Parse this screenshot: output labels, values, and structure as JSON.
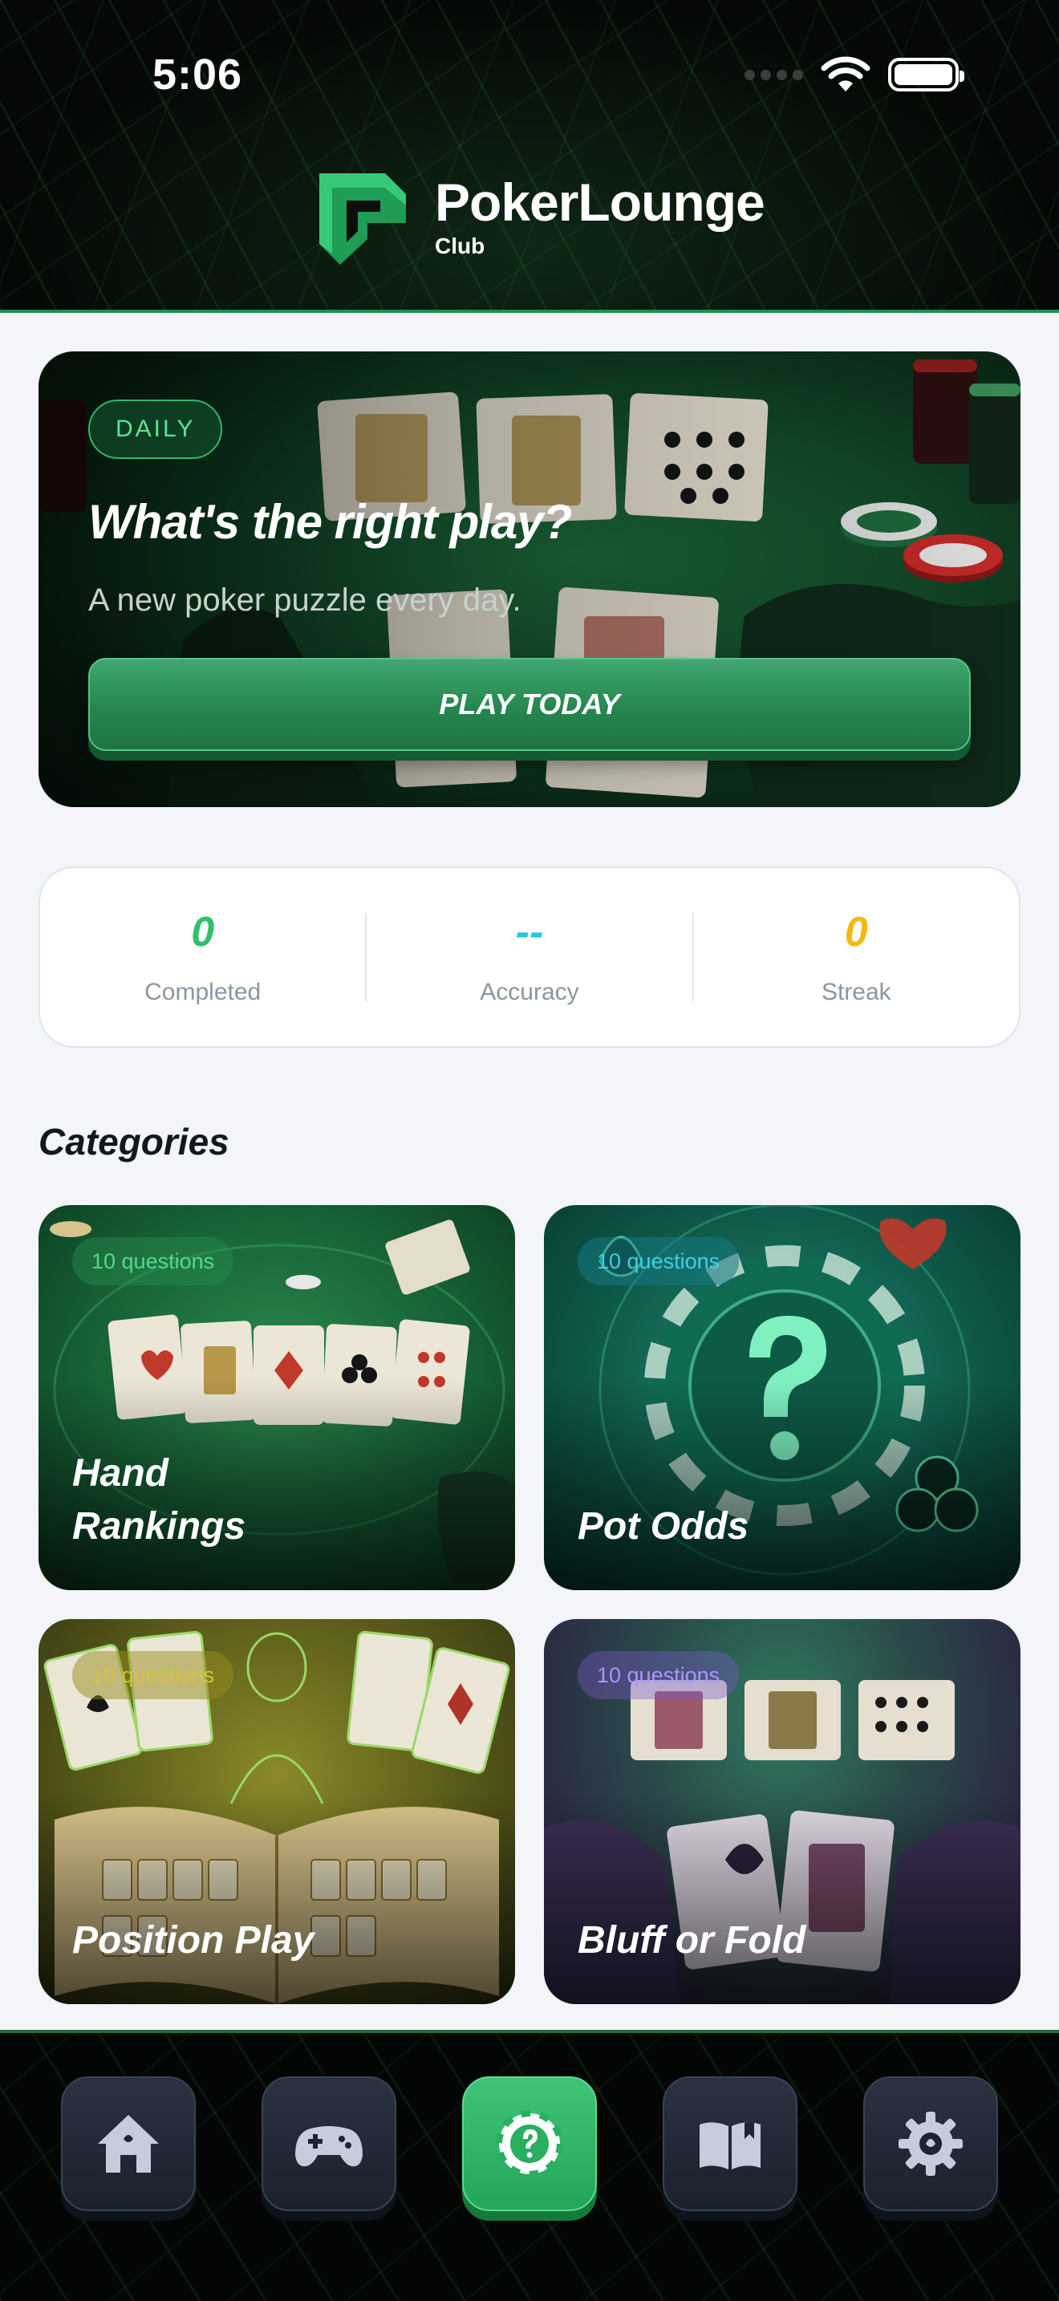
{
  "status_bar": {
    "time": "5:06"
  },
  "brand": {
    "name": "PokerLounge",
    "sub": "Club",
    "accent": "#2fc06b"
  },
  "daily": {
    "badge": "DAILY",
    "title": "What's the right play?",
    "subtitle": "A new poker puzzle every day.",
    "button": "PLAY TODAY"
  },
  "stats": [
    {
      "value": "0",
      "label": "Completed",
      "color": "#2fc06b"
    },
    {
      "value": "--",
      "label": "Accuracy",
      "color": "#27c6e0"
    },
    {
      "value": "0",
      "label": "Streak",
      "color": "#f2b90f"
    }
  ],
  "categories": {
    "title": "Categories",
    "items": [
      {
        "name": "Hand Rankings",
        "count": "10 questions",
        "theme": "green"
      },
      {
        "name": "Pot Odds",
        "count": "10 questions",
        "theme": "teal"
      },
      {
        "name": "Position Play",
        "count": "10 questions",
        "theme": "gold"
      },
      {
        "name": "Bluff or Fold",
        "count": "10 questions",
        "theme": "purple"
      }
    ]
  },
  "nav": {
    "items": [
      {
        "icon": "home-icon",
        "active": false
      },
      {
        "icon": "gamepad-icon",
        "active": false
      },
      {
        "icon": "chip-question-icon",
        "active": true
      },
      {
        "icon": "book-icon",
        "active": false
      },
      {
        "icon": "gear-icon",
        "active": false
      }
    ]
  }
}
